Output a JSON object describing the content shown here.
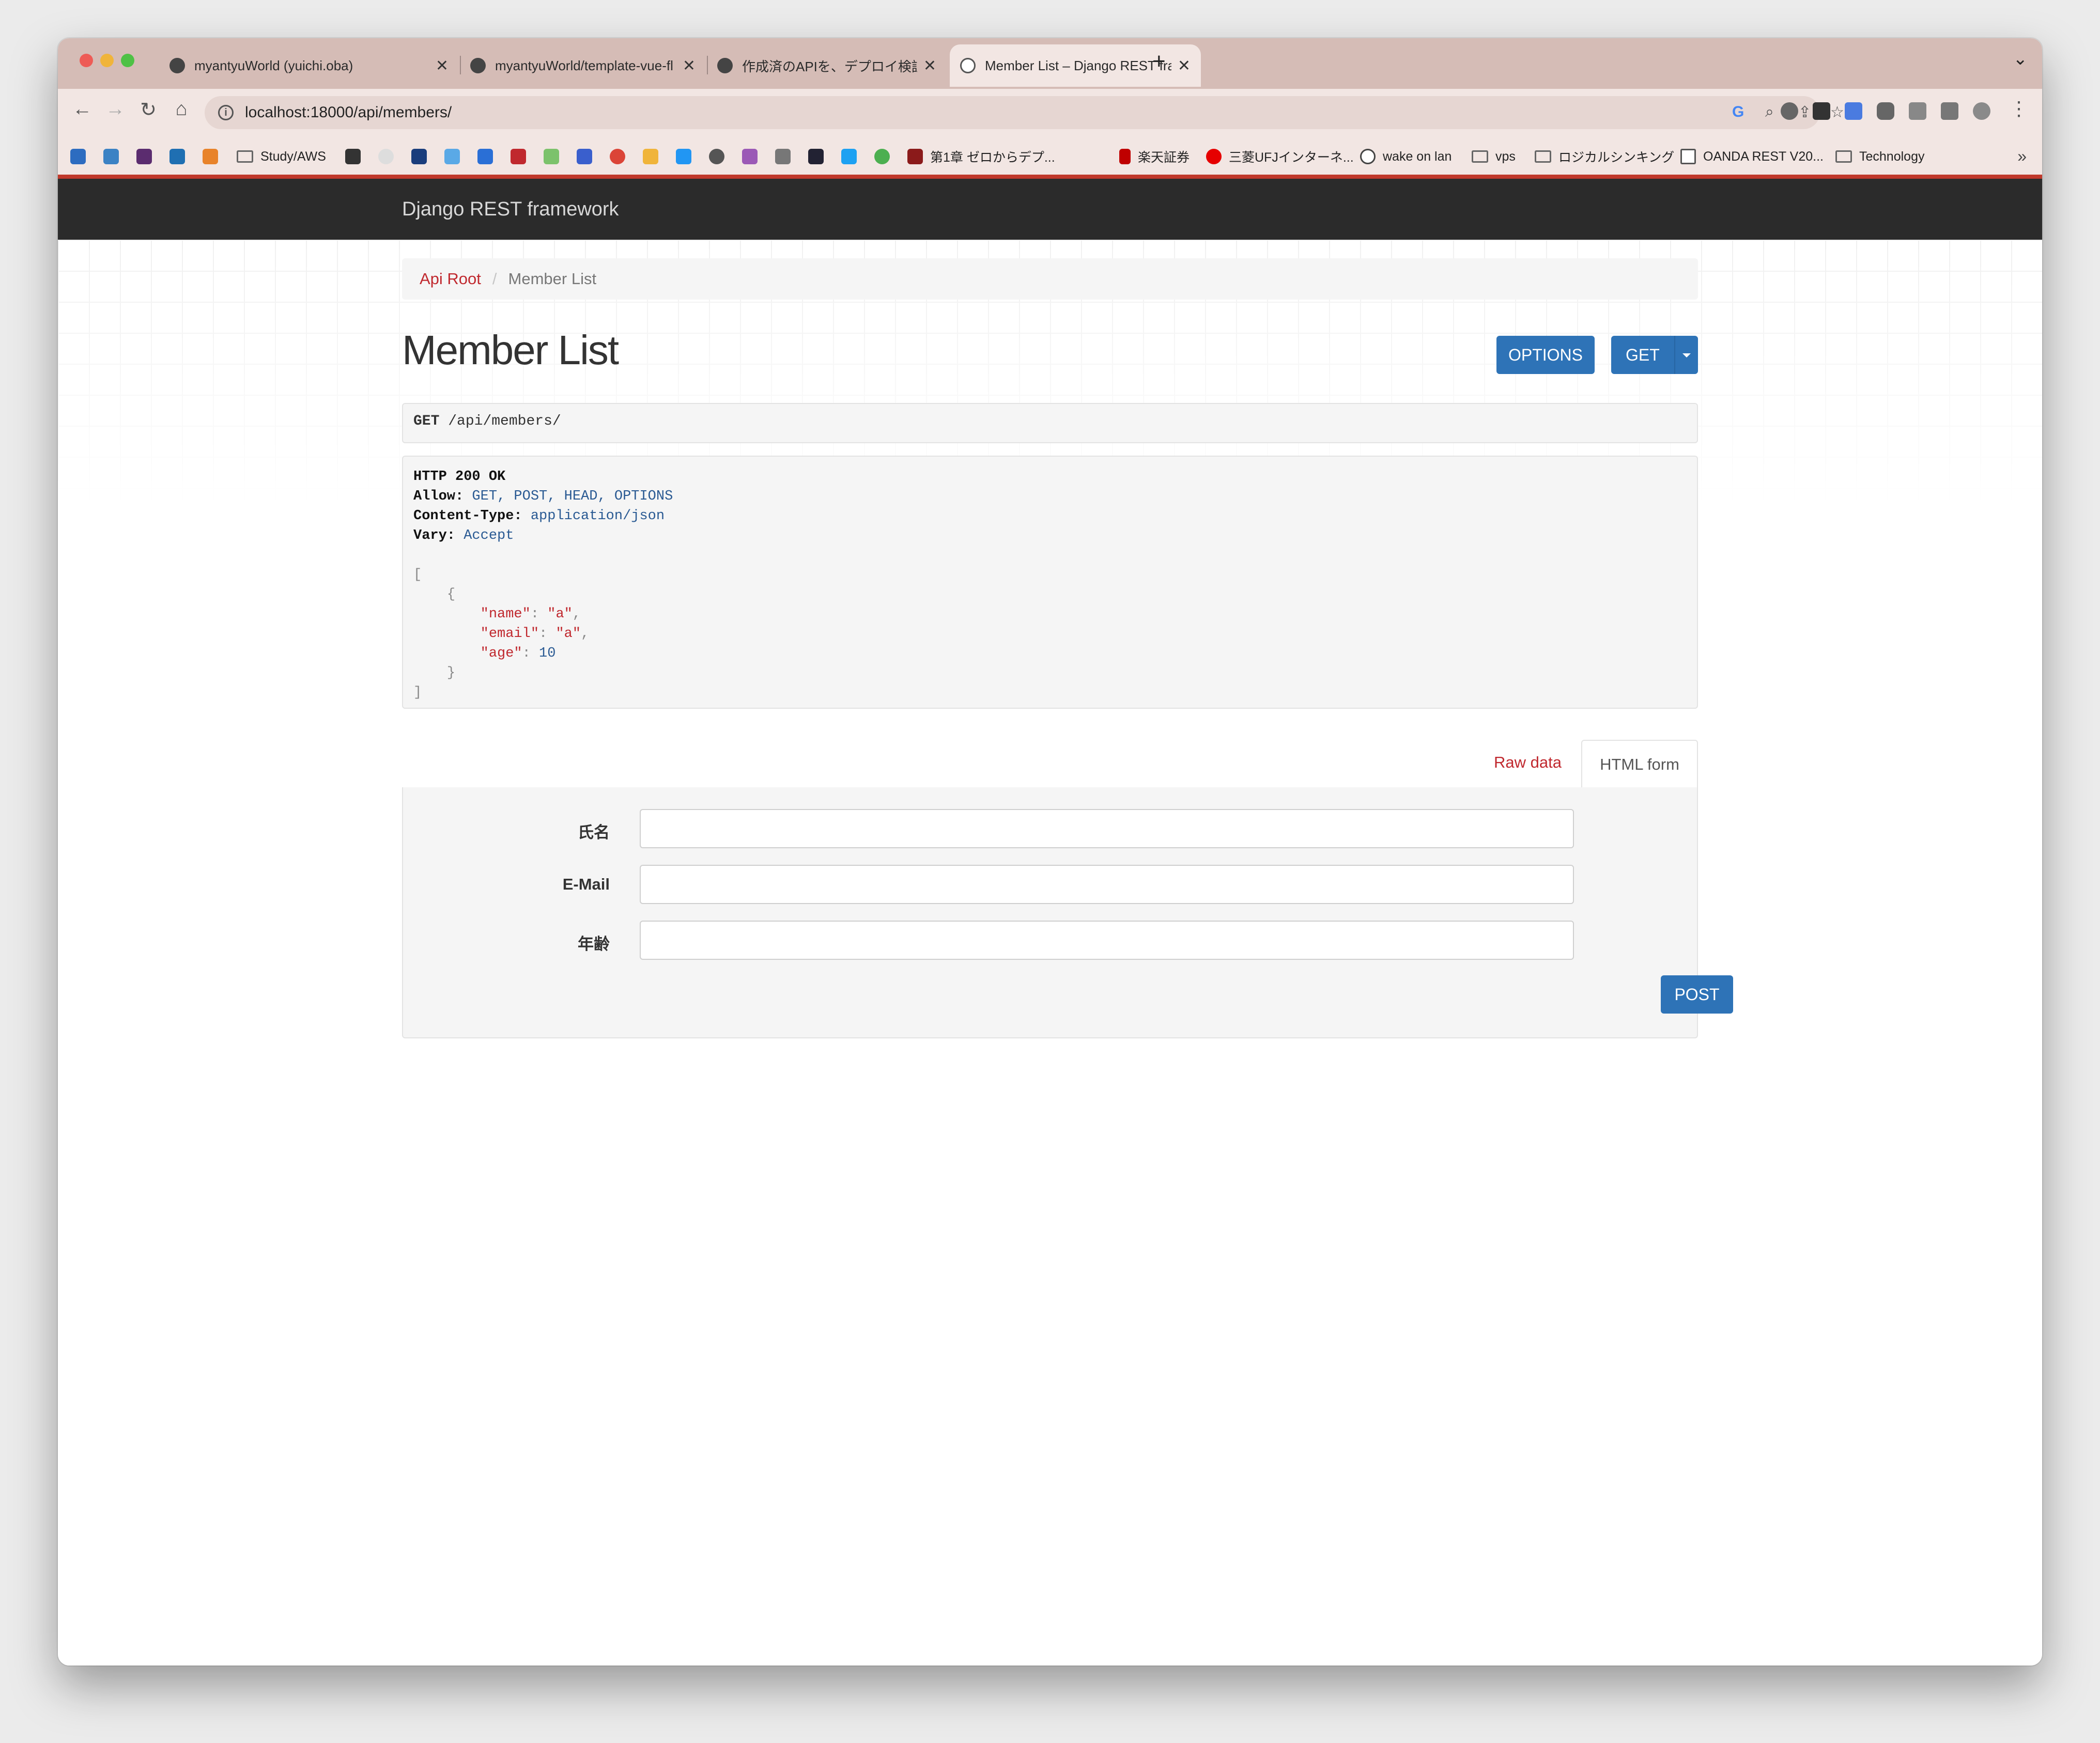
{
  "browser": {
    "tabs": [
      {
        "title": "myantyuWorld (yuichi.oba)",
        "close": "✕",
        "active": false
      },
      {
        "title": "myantyuWorld/template-vue-fl",
        "close": "✕",
        "active": false
      },
      {
        "title": "作成済のAPIを、デプロイ検証できる",
        "close": "✕",
        "active": false
      },
      {
        "title": "Member List – Django REST fra",
        "close": "✕",
        "active": true
      }
    ],
    "new_tab": "+",
    "tab_menu": "⌄",
    "url": "localhost:18000/api/members/",
    "bookmarks": [
      {
        "label": "Study/AWS",
        "type": "folder"
      },
      {
        "label": "第1章 ゼロからデプ...",
        "type": "link"
      },
      {
        "label": "楽天証券",
        "type": "link"
      },
      {
        "label": "三菱UFJインターネ...",
        "type": "link"
      },
      {
        "label": "wake on lan",
        "type": "link"
      },
      {
        "label": "vps",
        "type": "folder"
      },
      {
        "label": "ロジカルシンキング",
        "type": "folder"
      },
      {
        "label": "OANDA REST V20...",
        "type": "link"
      },
      {
        "label": "Technology",
        "type": "folder"
      }
    ],
    "bookmarks_more": "»"
  },
  "app": {
    "brand": "Django REST framework",
    "breadcrumb": {
      "root": "Api Root",
      "separator": "/",
      "current": "Member List"
    },
    "title": "Member List",
    "buttons": {
      "options": "OPTIONS",
      "get": "GET",
      "post": "POST"
    },
    "request": {
      "method": "GET",
      "path": "/api/members/"
    },
    "response": {
      "status": "HTTP 200 OK",
      "headers": [
        {
          "name": "Allow:",
          "value": "GET, POST, HEAD, OPTIONS"
        },
        {
          "name": "Content-Type:",
          "value": "application/json"
        },
        {
          "name": "Vary:",
          "value": "Accept"
        }
      ],
      "body": {
        "open_bracket": "[",
        "open_brace": "{",
        "fields": [
          {
            "key": "\"name\"",
            "value": "\"a\"",
            "comma": ","
          },
          {
            "key": "\"email\"",
            "value": "\"a\"",
            "comma": ","
          },
          {
            "key": "\"age\"",
            "value": "10",
            "comma": ""
          }
        ],
        "close_brace": "}",
        "close_bracket": "]"
      }
    },
    "content_tabs": {
      "raw": "Raw data",
      "html": "HTML form"
    },
    "form": {
      "fields": [
        {
          "label": "氏名",
          "value": ""
        },
        {
          "label": "E-Mail",
          "value": ""
        },
        {
          "label": "年齢",
          "value": ""
        }
      ]
    }
  },
  "colors": {
    "accent_red": "#c0282e",
    "button_blue": "#2e73b7",
    "navbar": "#2b2b2b",
    "tabstrip": "#d5bcb6"
  }
}
